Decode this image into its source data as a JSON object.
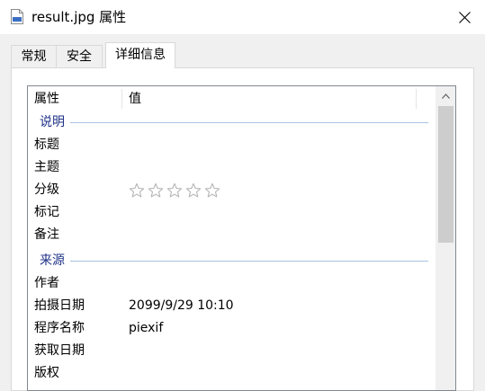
{
  "window": {
    "title": "result.jpg 属性",
    "icon": "jpg-file-icon"
  },
  "tabs": [
    {
      "label": "常规"
    },
    {
      "label": "安全"
    },
    {
      "label": "详细信息",
      "selected": true
    }
  ],
  "list": {
    "columns": {
      "property": "属性",
      "value": "值"
    },
    "groups": {
      "description": {
        "label": "说明",
        "rows": [
          {
            "key": "标题",
            "value": ""
          },
          {
            "key": "主题",
            "value": ""
          },
          {
            "key": "分级",
            "rating": 0,
            "max_rating": 5
          },
          {
            "key": "标记",
            "value": ""
          },
          {
            "key": "备注",
            "value": ""
          }
        ]
      },
      "origin": {
        "label": "来源",
        "rows": [
          {
            "key": "作者",
            "value": ""
          },
          {
            "key": "拍摄日期",
            "value": "2099/9/29 10:10"
          },
          {
            "key": "程序名称",
            "value": "piexif"
          },
          {
            "key": "获取日期",
            "value": ""
          },
          {
            "key": "版权",
            "value": ""
          }
        ]
      }
    },
    "scrollbar": {
      "position_fraction": 0.0
    }
  },
  "colors": {
    "group_label": "#1e3287",
    "group_line": "#a6c3e5",
    "star_outline": "#b4b4b4"
  }
}
